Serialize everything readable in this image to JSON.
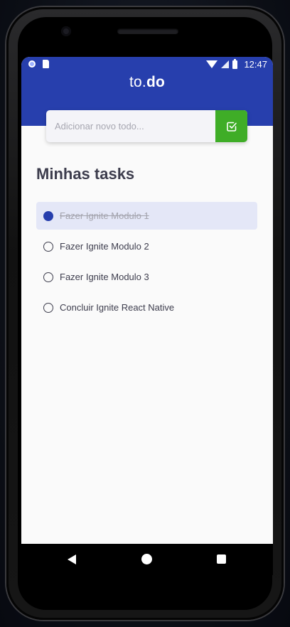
{
  "status_bar": {
    "time": "12:47"
  },
  "header": {
    "logo_prefix": "to.",
    "logo_suffix": "do",
    "brand_color": "#273fad"
  },
  "add_todo": {
    "placeholder": "Adicionar novo todo...",
    "button_color": "#3fad27",
    "button_icon": "check-square-icon"
  },
  "main": {
    "title": "Minhas tasks",
    "tasks": [
      {
        "label": "Fazer Ignite Modulo 1",
        "done": true
      },
      {
        "label": "Fazer Ignite Modulo 2",
        "done": false
      },
      {
        "label": "Fazer Ignite Modulo 3",
        "done": false
      },
      {
        "label": "Concluir Ignite React Native",
        "done": false
      }
    ]
  },
  "nav_bar": {
    "buttons": [
      "back-icon",
      "home-icon",
      "recent-apps-icon"
    ]
  }
}
